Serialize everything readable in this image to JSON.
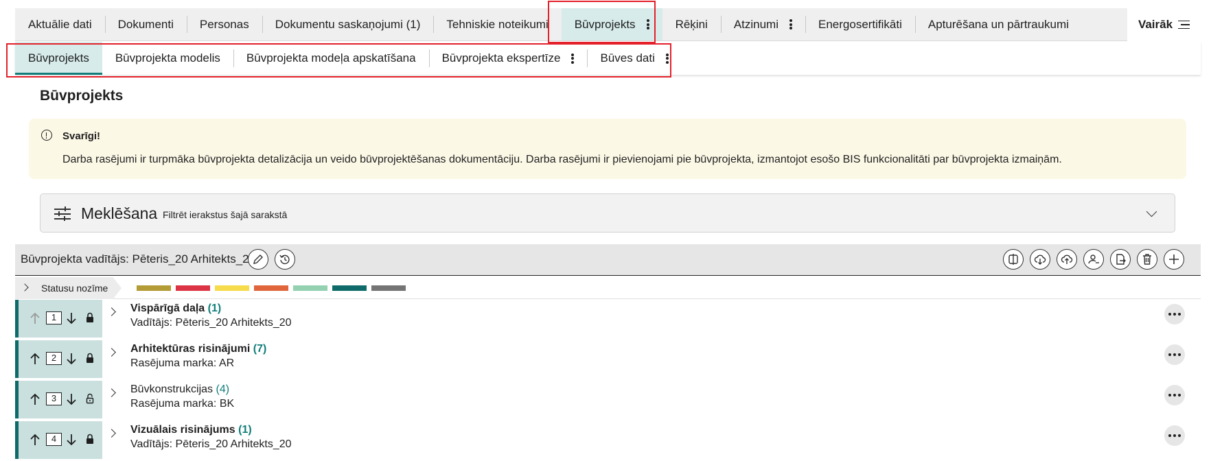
{
  "top_tabs": [
    {
      "label": "Aktuālie dati"
    },
    {
      "label": "Dokumenti"
    },
    {
      "label": "Personas"
    },
    {
      "label": "Dokumentu saskaņojumi (1)"
    },
    {
      "label": "Tehniskie noteikumi"
    },
    {
      "label": "Būvprojekts",
      "active": true,
      "menu": true
    },
    {
      "label": "Rēķini"
    },
    {
      "label": "Atzinumi",
      "menu": true
    },
    {
      "label": "Energosertifikāti"
    },
    {
      "label": "Apturēšana un pārtraukumi"
    }
  ],
  "more_label": "Vairāk",
  "sub_tabs": [
    {
      "label": "Būvprojekts",
      "active": true
    },
    {
      "label": "Būvprojekta modelis"
    },
    {
      "label": "Būvprojekta modeļa apskatīšana"
    },
    {
      "label": "Būvprojekta ekspertīze",
      "menu": true
    },
    {
      "label": "Būves dati",
      "menu": true
    }
  ],
  "page_title": "Būvprojekts",
  "alert": {
    "title": "Svarīgi!",
    "body": "Darba rasējumi ir turpmāka būvprojekta detalizācija un veido būvprojektēšanas dokumentāciju. Darba rasējumi ir pievienojami pie būvprojekta, izmantojot esošo BIS funkcionalitāti par būvprojekta izmaiņām."
  },
  "search": {
    "title": "Meklēšana",
    "subtitle": "Filtrēt ierakstus šajā sarakstā"
  },
  "manager": {
    "label": "Būvprojekta vadītājs: Pēteris_20 Arhitekts_20"
  },
  "toolbar_icons": [
    "compare-icon",
    "cloud-download-icon",
    "cloud-upload-icon",
    "user-assign-icon",
    "document-export-icon",
    "delete-icon",
    "add-icon"
  ],
  "status_legend": {
    "label": "Statusu nozīme",
    "colors": [
      "#b39b35",
      "#dc3445",
      "#f6dc4a",
      "#e0653b",
      "#93d1b1",
      "#0f6b69",
      "#747474"
    ]
  },
  "accent_color": "#0f6b69",
  "rows": [
    {
      "order": "1",
      "title": "Vispārīgā daļa",
      "count": "(1)",
      "subtitle": "Vadītājs: Pēteris_20 Arhitekts_20",
      "bold": true,
      "locked": true,
      "up_enabled": false
    },
    {
      "order": "2",
      "title": "Arhitektūras risinājumi",
      "count": "(7)",
      "subtitle": "Rasējuma marka: AR",
      "bold": true,
      "locked": true,
      "up_enabled": true
    },
    {
      "order": "3",
      "title": "Būvkonstrukcijas",
      "count": "(4)",
      "subtitle": "Rasējuma marka: BK",
      "bold": false,
      "locked": false,
      "up_enabled": true
    },
    {
      "order": "4",
      "title": "Vizuālais risinājums",
      "count": "(1)",
      "subtitle": "Vadītājs: Pēteris_20 Arhitekts_20",
      "bold": true,
      "locked": true,
      "up_enabled": true
    }
  ]
}
